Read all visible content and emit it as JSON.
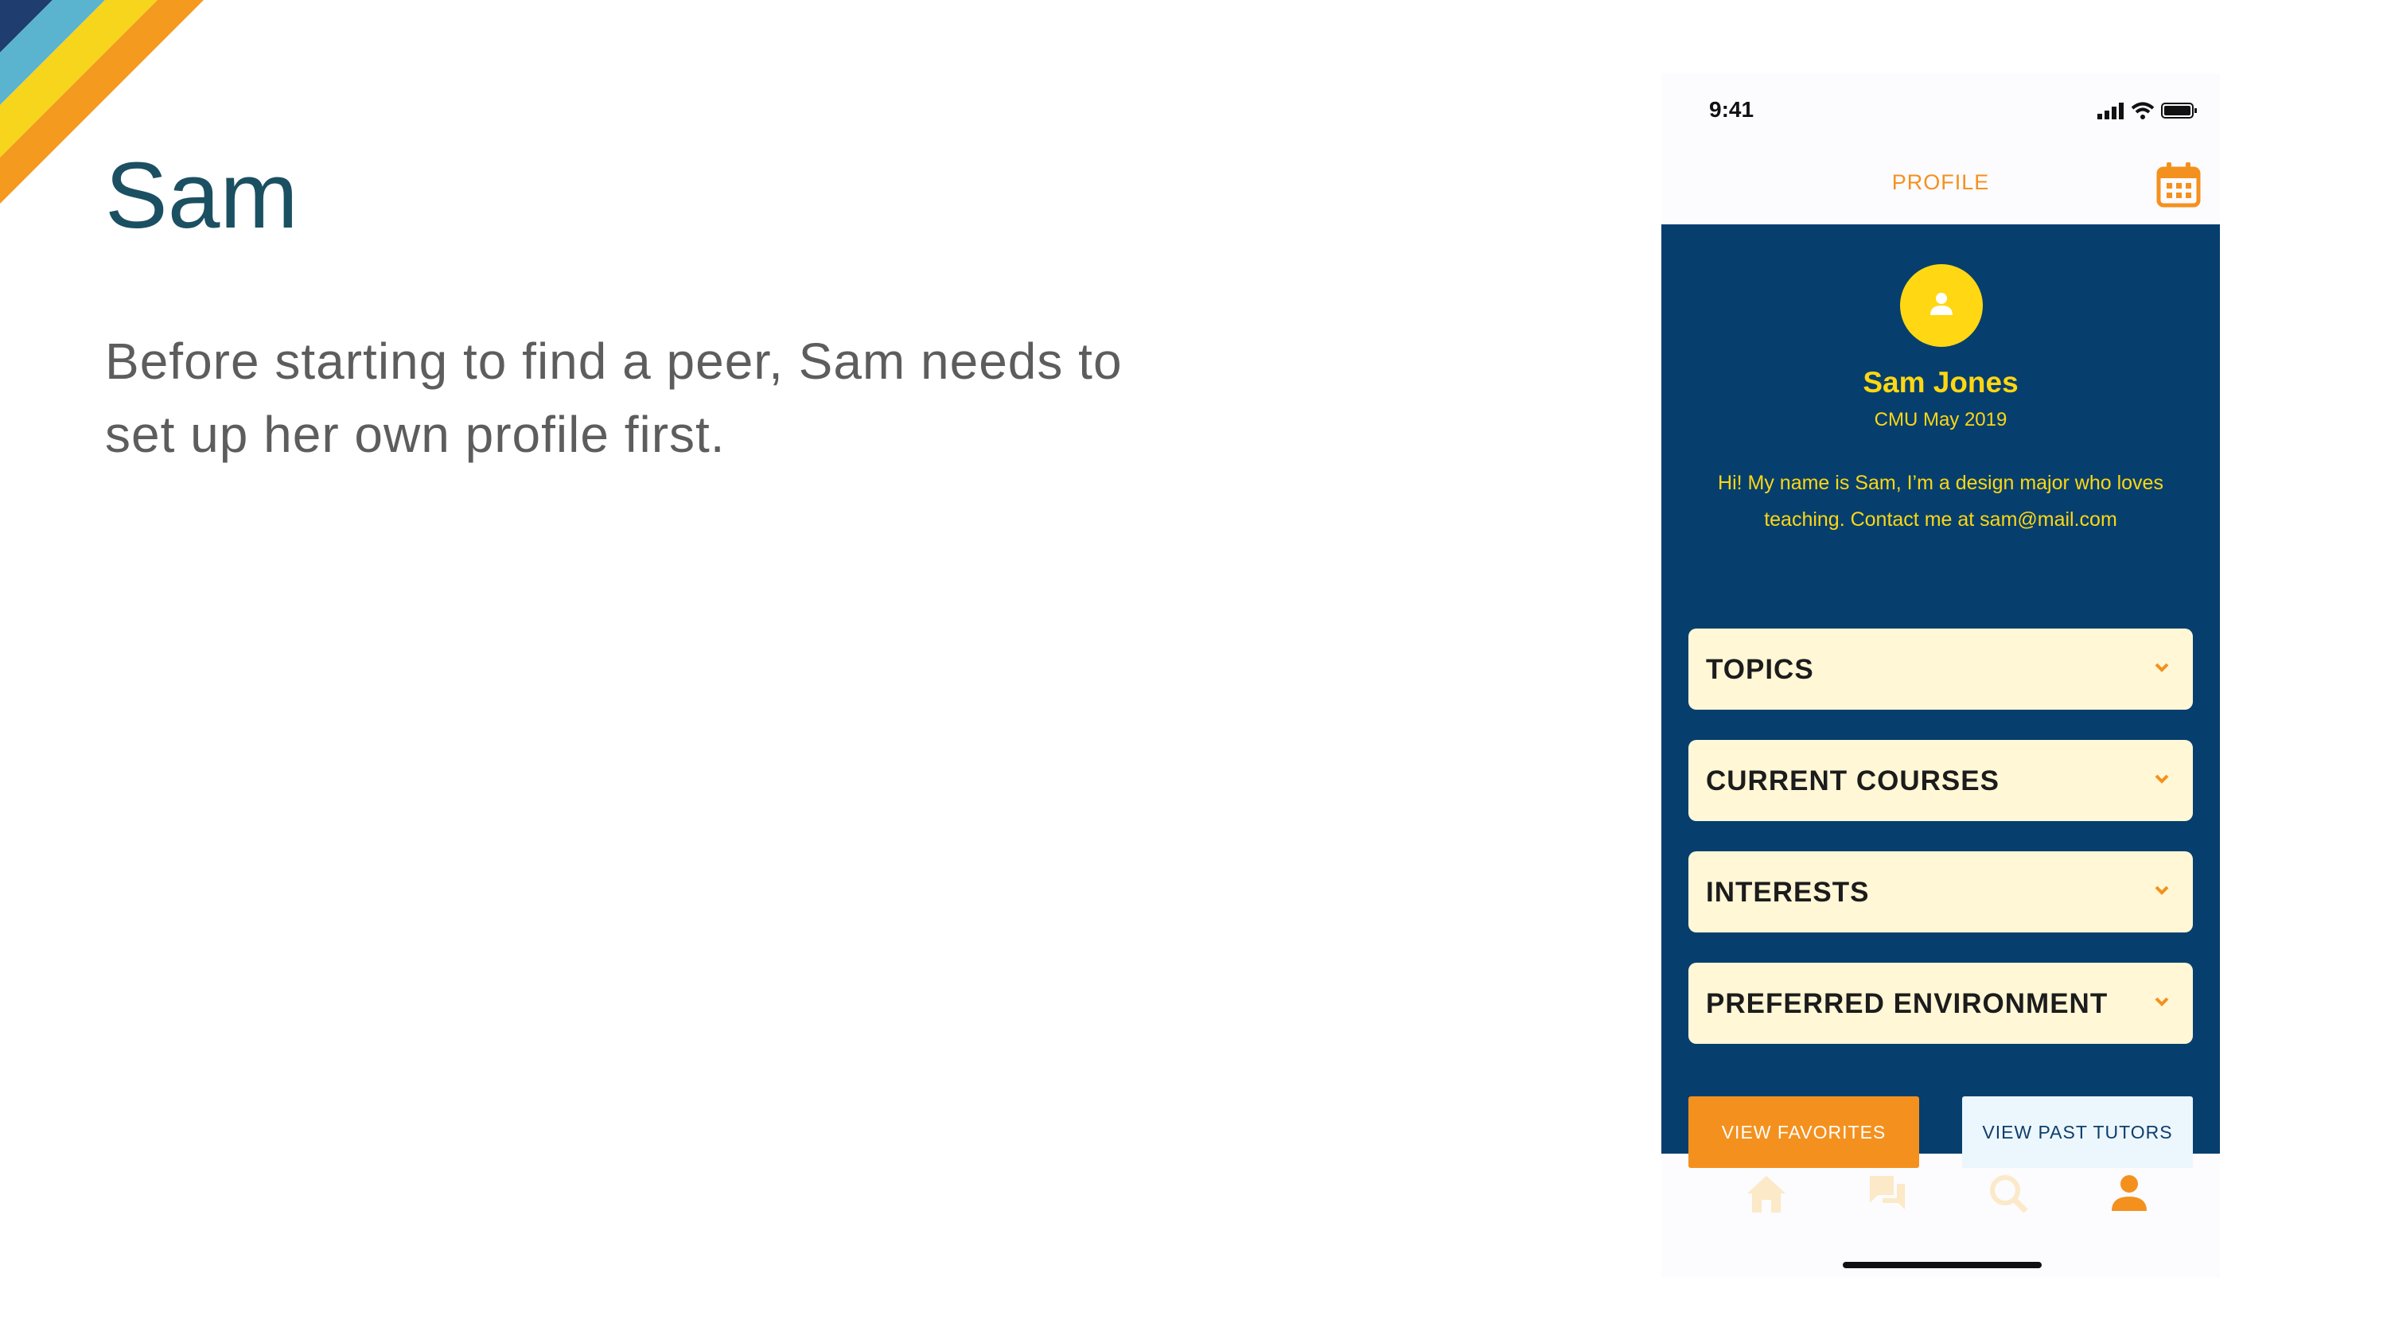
{
  "colors": {
    "title": "#1b5062",
    "navy": "#063f6e",
    "yellow": "#ffd712",
    "orange": "#f4911e",
    "cream": "#fff7d6",
    "stripe_colors": [
      "#1f3d6e",
      "#5ab4cf",
      "#f7d51d",
      "#f39a1f"
    ]
  },
  "slide": {
    "title": "Sam",
    "body": "Before starting to find a peer, Sam needs to set up her own profile first."
  },
  "phone": {
    "status": {
      "time": "9:41",
      "icons": [
        "signal-icon",
        "wifi-icon",
        "battery-icon"
      ]
    },
    "app_bar": {
      "title": "PROFILE",
      "right_icon": "calendar-icon"
    },
    "profile": {
      "avatar_icon": "user-icon",
      "name": "Sam Jones",
      "school": "CMU May 2019",
      "bio": "Hi! My name is Sam, I’m a design major who loves teaching. Contact me at sam@mail.com"
    },
    "sections": [
      {
        "label": "TOPICS",
        "icon": "chevron-down-icon"
      },
      {
        "label": "CURRENT COURSES",
        "icon": "chevron-down-icon"
      },
      {
        "label": "INTERESTS",
        "icon": "chevron-down-icon"
      },
      {
        "label": "PREFERRED ENVIRONMENT",
        "icon": "chevron-down-icon"
      }
    ],
    "buttons": {
      "favorites": "VIEW FAVORITES",
      "past_tutors": "VIEW PAST TUTORS"
    },
    "tab_bar": {
      "tabs": [
        {
          "icon": "home-icon",
          "active": false
        },
        {
          "icon": "chat-icon",
          "active": false
        },
        {
          "icon": "search-icon",
          "active": false
        },
        {
          "icon": "profile-icon",
          "active": true
        }
      ]
    }
  }
}
